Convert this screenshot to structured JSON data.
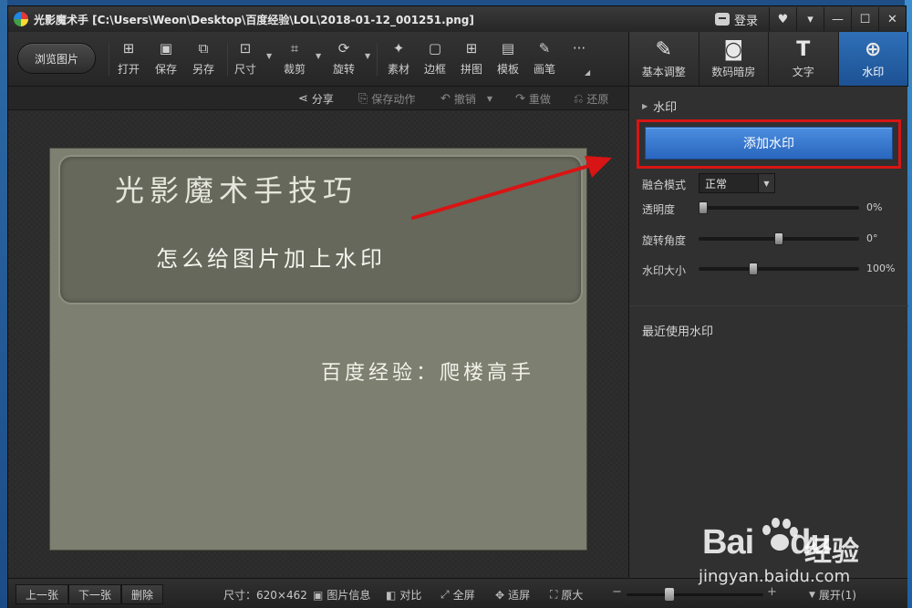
{
  "window": {
    "title": "光影魔术手  [C:\\Users\\Weon\\Desktop\\百度经验\\LOL\\2018-01-12_001251.png]",
    "login_label": "登录",
    "controls": [
      "♥",
      "▾",
      "—",
      "☐",
      "✕"
    ]
  },
  "toolbar": {
    "browse_label": "浏览图片",
    "tools": [
      {
        "icon": "open-icon",
        "glyph": "⊞",
        "label": "打开"
      },
      {
        "icon": "save-icon",
        "glyph": "▣",
        "label": "保存"
      },
      {
        "icon": "save-as-icon",
        "glyph": "⧉",
        "label": "另存"
      },
      {
        "icon": "size-icon",
        "glyph": "⊡",
        "label": "尺寸"
      },
      {
        "icon": "crop-icon",
        "glyph": "⌗",
        "label": "裁剪"
      },
      {
        "icon": "rotate-icon",
        "glyph": "⟳",
        "label": "旋转"
      },
      {
        "icon": "material-icon",
        "glyph": "✦",
        "label": "素材"
      },
      {
        "icon": "frame-icon",
        "glyph": "▢",
        "label": "边框"
      },
      {
        "icon": "collage-icon",
        "glyph": "⊞",
        "label": "拼图"
      },
      {
        "icon": "template-icon",
        "glyph": "▤",
        "label": "模板"
      },
      {
        "icon": "brush-icon",
        "glyph": "✎",
        "label": "画笔"
      }
    ],
    "more_glyph": "···"
  },
  "actionbar": {
    "share": "分享",
    "save_action": "保存动作",
    "undo": "撤销",
    "redo": "重做",
    "restore": "还原"
  },
  "image": {
    "title": "光影魔术手技巧",
    "subtitle": "怎么给图片加上水印",
    "watermark": "百度经验：爬楼高手"
  },
  "statusbar": {
    "prev": "上一张",
    "next": "下一张",
    "delete": "删除",
    "size": "尺寸：620×462",
    "info": "图片信息",
    "compare": "对比",
    "fullscreen": "全屏",
    "fit": "适屏",
    "original": "原大",
    "minus": "−",
    "plus": "+",
    "expand": "展开(1)"
  },
  "panel": {
    "tabs": [
      {
        "icon": "basic-adjust-icon",
        "glyph": "✎",
        "label": "基本调整"
      },
      {
        "icon": "darkroom-icon",
        "glyph": "◙",
        "label": "数码暗房"
      },
      {
        "icon": "text-icon",
        "glyph": "T",
        "label": "文字"
      },
      {
        "icon": "watermark-icon",
        "glyph": "⊕",
        "label": "水印"
      }
    ],
    "section_title": "水印",
    "add_button": "添加水印",
    "blend_label": "融合模式",
    "blend_value": "正常",
    "opacity_label": "透明度",
    "opacity_value": "0%",
    "rotation_label": "旋转角度",
    "rotation_value": "0°",
    "size_label": "水印大小",
    "size_value": "100%",
    "recent_title": "最近使用水印"
  },
  "sliders": {
    "opacity": 0.0,
    "rotation": 0.5,
    "size": 0.33,
    "zoom": 0.3
  },
  "overlay": {
    "baidu_logo": "Bai",
    "baidu_logo_end": "du",
    "baidu_cn": "经验",
    "baidu_url": "jingyan.baidu.com"
  },
  "colors": {
    "accent": "#2a66be",
    "highlight": "#d81414"
  }
}
